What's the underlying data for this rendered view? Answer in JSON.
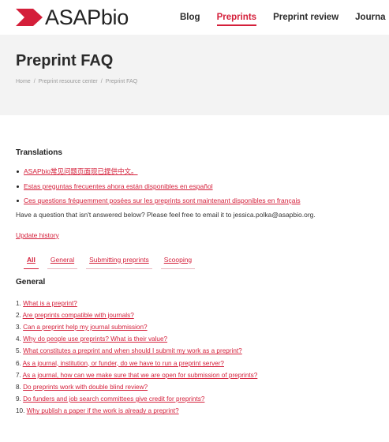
{
  "brand": {
    "logo_text": "ASAPbio",
    "accent_color": "#d41f3a",
    "icon": "asapbio-chevron-logo"
  },
  "nav": {
    "items": [
      {
        "label": "Blog",
        "active": false
      },
      {
        "label": "Preprints",
        "active": true
      },
      {
        "label": "Preprint review",
        "active": false
      },
      {
        "label": "Journa",
        "active": false
      }
    ]
  },
  "hero": {
    "title": "Preprint FAQ",
    "breadcrumb": [
      "Home",
      "Preprint resource center",
      "Preprint FAQ"
    ],
    "breadcrumb_separator": "/"
  },
  "translations": {
    "heading": "Translations",
    "items": [
      "ASAPbio常见问题页面现已提供中文。",
      "Estas preguntas frecuentes ahora están disponibles en español",
      "Ces questions fréquemment posées sur les preprints sont maintenant disponibles en français"
    ]
  },
  "question_text": "Have a question that isn't answered below? Please feel free to email it to jessica.polka@asapbio.org.",
  "update_history": "Update history",
  "tabs": [
    {
      "label": "All",
      "active": true
    },
    {
      "label": "General",
      "active": false
    },
    {
      "label": "Submitting preprints",
      "active": false
    },
    {
      "label": "Scooping",
      "active": false
    }
  ],
  "general": {
    "heading": "General",
    "questions": [
      {
        "num": "1.",
        "text": "What is a preprint?"
      },
      {
        "num": "2.",
        "text": "Are preprints compatible with journals?"
      },
      {
        "num": "3.",
        "text": "Can a preprint help my journal submission?"
      },
      {
        "num": "4.",
        "text": "Why do people use preprints? What is their value?"
      },
      {
        "num": "5.",
        "text": "What constitutes a preprint and when should I submit my work as a preprint?"
      },
      {
        "num": "6.",
        "text": "As a journal, institution, or funder, do we have to run a preprint server?"
      },
      {
        "num": "7.",
        "text": "As a journal, how can we make sure that we are open for submission of preprints?"
      },
      {
        "num": "8.",
        "text": "Do preprints work with double blind review?"
      },
      {
        "num": "9.",
        "text": "Do funders and job search committees give credit for preprints?"
      },
      {
        "num": "10.",
        "text": "Why publish a paper if the work is already a preprint?"
      }
    ]
  }
}
